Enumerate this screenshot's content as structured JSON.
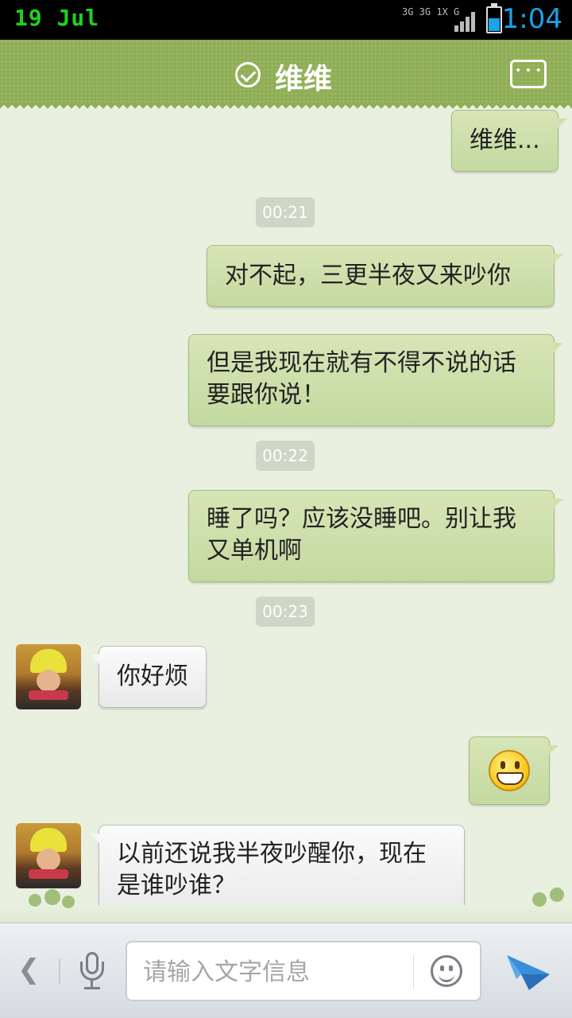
{
  "status_bar": {
    "date": "19 Jul",
    "network_top": "3G 3G 1X G",
    "time": "1:04",
    "battery_level": 0.55,
    "battery_color": "#1aa3e6",
    "date_color": "#1fd21f"
  },
  "header": {
    "title": "维维",
    "status_icon": "check-circle-icon",
    "menu_icon": "more-options-icon",
    "background": "#8fae55"
  },
  "messages": [
    {
      "type": "out",
      "text": "维维..."
    },
    {
      "type": "time",
      "text": "00:21"
    },
    {
      "type": "out",
      "text": "对不起，三更半夜又来吵你"
    },
    {
      "type": "out",
      "text": "但是我现在就有不得不说的话要跟你说！"
    },
    {
      "type": "time",
      "text": "00:22"
    },
    {
      "type": "out",
      "text": "睡了吗？应该没睡吧。别让我又单机啊"
    },
    {
      "type": "time",
      "text": "00:23"
    },
    {
      "type": "in",
      "text": "你好烦"
    },
    {
      "type": "out",
      "emoji": "grin-emoji"
    },
    {
      "type": "in",
      "text": "以前还说我半夜吵醒你，现在是谁吵谁？"
    }
  ],
  "input_bar": {
    "back_icon": "chevron-left-icon",
    "voice_icon": "microphone-icon",
    "placeholder": "请输入文字信息",
    "emoji_icon": "smiley-icon",
    "send_icon": "send-icon"
  }
}
